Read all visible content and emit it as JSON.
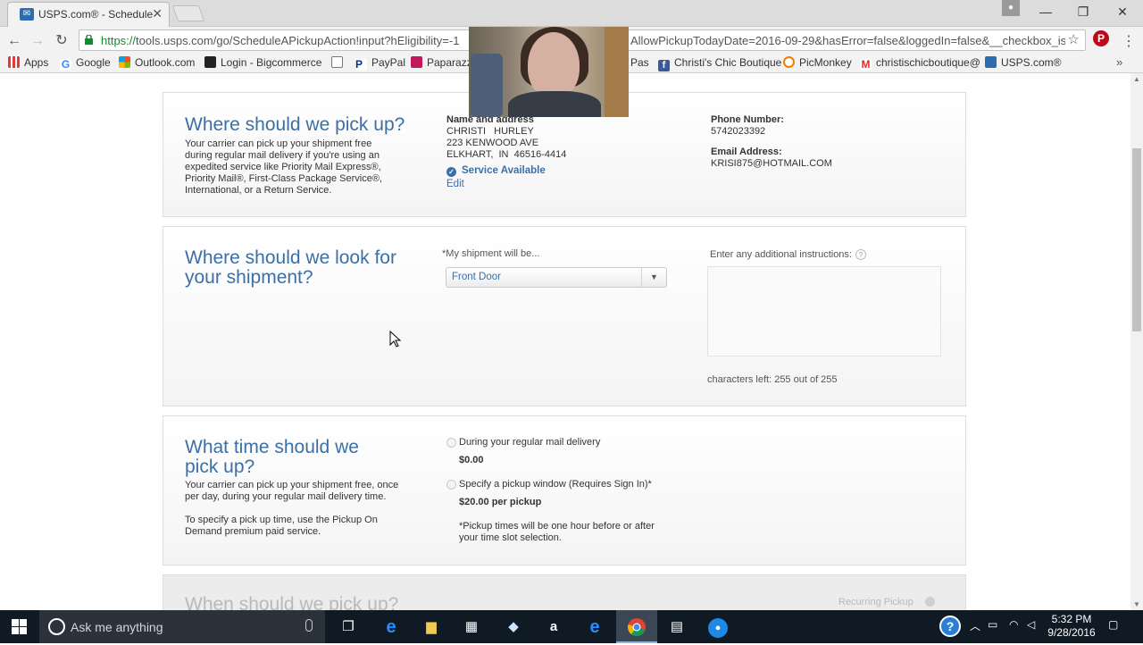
{
  "browser": {
    "tab_title": "USPS.com® - Schedule a",
    "url_scheme": "https://",
    "url_main": "tools.usps.com/go/ScheduleAPickupAction!input?hEligibility=-1",
    "url_tail": "AllowPickupTodayDate=2016-09-29&hasError=false&loggedIn=false&__checkbox_is",
    "bookmarks": [
      "Apps",
      "Google",
      "Outlook.com",
      "Login - Bigcommerce",
      "PayPal",
      "Paparazzi",
      "Pas",
      "Christi's Chic Boutique",
      "PicMonkey",
      "christischicboutique@",
      "USPS.com®"
    ]
  },
  "pickup_location": {
    "title": "Where should we pick up?",
    "description": [
      "Your carrier can pick up your shipment free",
      "during regular mail delivery if you're using an",
      "expedited service like Priority Mail Express®,",
      "Priority Mail®, First-Class Package Service®,",
      "International, or a Return Service."
    ],
    "name_label": "Name and address",
    "name": "CHRISTI   HURLEY",
    "street": "223 KENWOOD AVE",
    "city": "ELKHART,  IN  46516-4414",
    "service_status": "Service Available",
    "edit_label": "Edit",
    "phone_label": "Phone Number:",
    "phone": "5742023392",
    "email_label": "Email Address:",
    "email": "KRISI875@HOTMAIL.COM"
  },
  "shipment_location": {
    "title_line1": "Where should we look for",
    "title_line2": "your shipment?",
    "select_label": "*My shipment will be...",
    "select_value": "Front Door",
    "instructions_label": "Enter any additional instructions:",
    "chars_left": "characters left: 255 out of 255"
  },
  "pickup_time": {
    "title_line1": "What time should we",
    "title_line2": "pick up?",
    "desc1": [
      "Your carrier can pick up your shipment free, once",
      "per day, during your regular mail delivery time."
    ],
    "desc2": [
      "To specify a pick up time, use the Pickup On",
      "Demand premium paid service."
    ],
    "option1_label": "During your regular mail delivery",
    "option1_price": "$0.00",
    "option2_label": "Specify a pickup window (Requires Sign In)*",
    "option2_price": "$20.00 per pickup",
    "footnote": [
      "*Pickup times will be one hour before or after",
      "your time slot selection."
    ]
  },
  "next_section": {
    "title": "When should we pick up?",
    "recurring": "Recurring Pickup"
  },
  "taskbar": {
    "search_placeholder": "Ask me anything",
    "time": "5:32 PM",
    "date": "9/28/2016"
  },
  "colors": {
    "usps_blue": "#3b6fa6",
    "taskbar": "#101a24"
  }
}
